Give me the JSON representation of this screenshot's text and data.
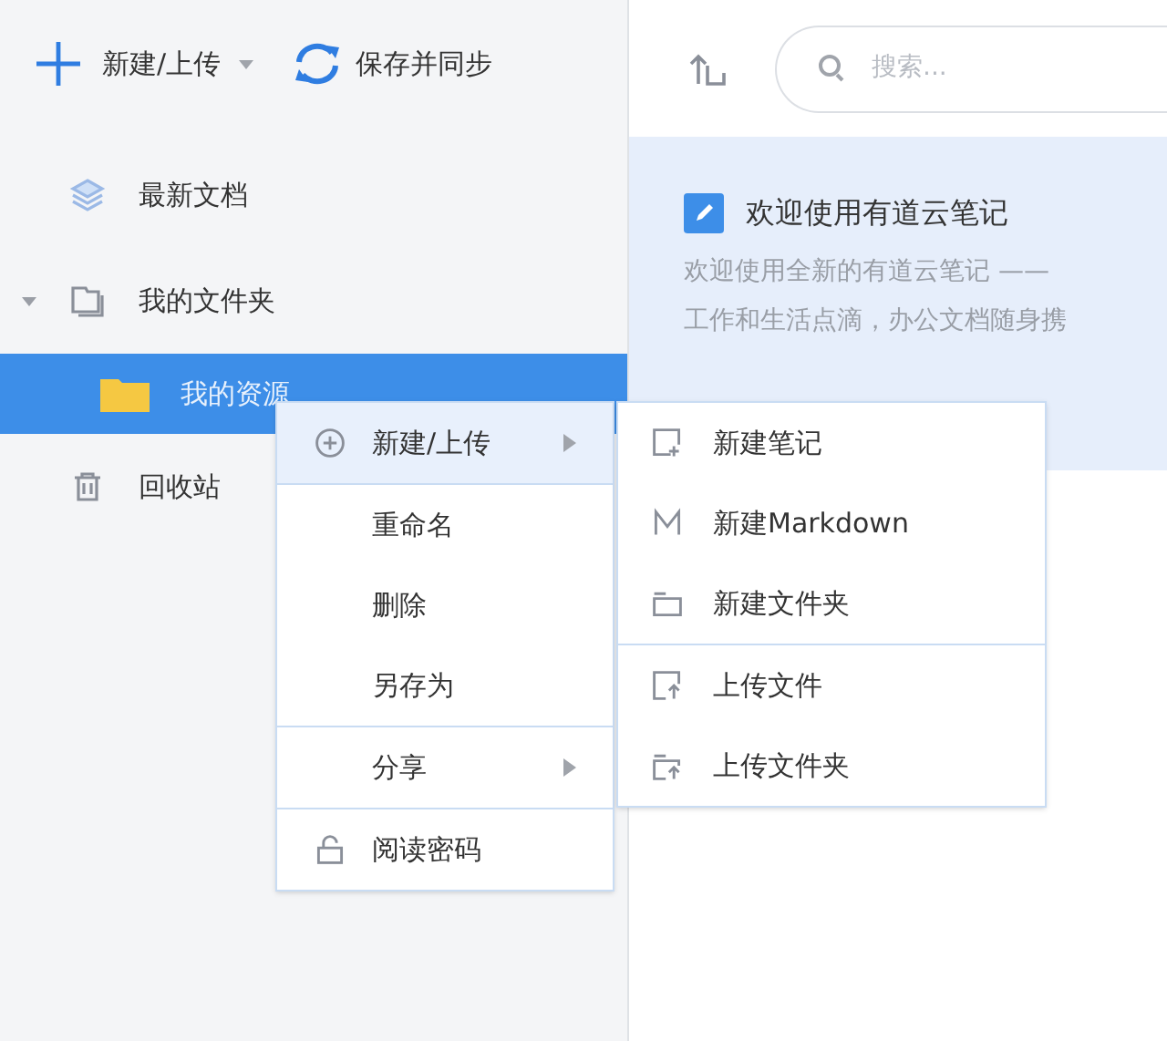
{
  "toolbar": {
    "new_button": "新建/上传",
    "sync_button": "保存并同步"
  },
  "sidebar": {
    "items": [
      {
        "label": "最新文档",
        "selected": false
      },
      {
        "label": "我的文件夹",
        "selected": false,
        "expanded": true,
        "children": [
          {
            "label": "我的资源",
            "selected": true
          }
        ]
      },
      {
        "label": "回收站",
        "selected": false
      }
    ]
  },
  "search": {
    "placeholder": "搜索..."
  },
  "note_card": {
    "title": "欢迎使用有道云笔记",
    "lines": [
      "欢迎使用全新的有道云笔记 ——",
      "工作和生活点滴，办公文档随身携"
    ]
  },
  "context_menu": {
    "groups": [
      [
        {
          "label": "新建/上传",
          "submenu": true,
          "highlighted": true
        }
      ],
      [
        {
          "label": "重命名",
          "submenu": false,
          "highlighted": false
        },
        {
          "label": "删除",
          "submenu": false,
          "highlighted": false
        },
        {
          "label": "另存为",
          "submenu": false,
          "highlighted": false
        }
      ],
      [
        {
          "label": "分享",
          "submenu": true,
          "highlighted": false
        }
      ],
      [
        {
          "label": "阅读密码",
          "submenu": false,
          "highlighted": false
        }
      ]
    ]
  },
  "submenu": {
    "groups": [
      [
        {
          "label": "新建笔记"
        },
        {
          "label": "新建Markdown"
        },
        {
          "label": "新建文件夹"
        }
      ],
      [
        {
          "label": "上传文件"
        },
        {
          "label": "上传文件夹"
        }
      ]
    ]
  }
}
